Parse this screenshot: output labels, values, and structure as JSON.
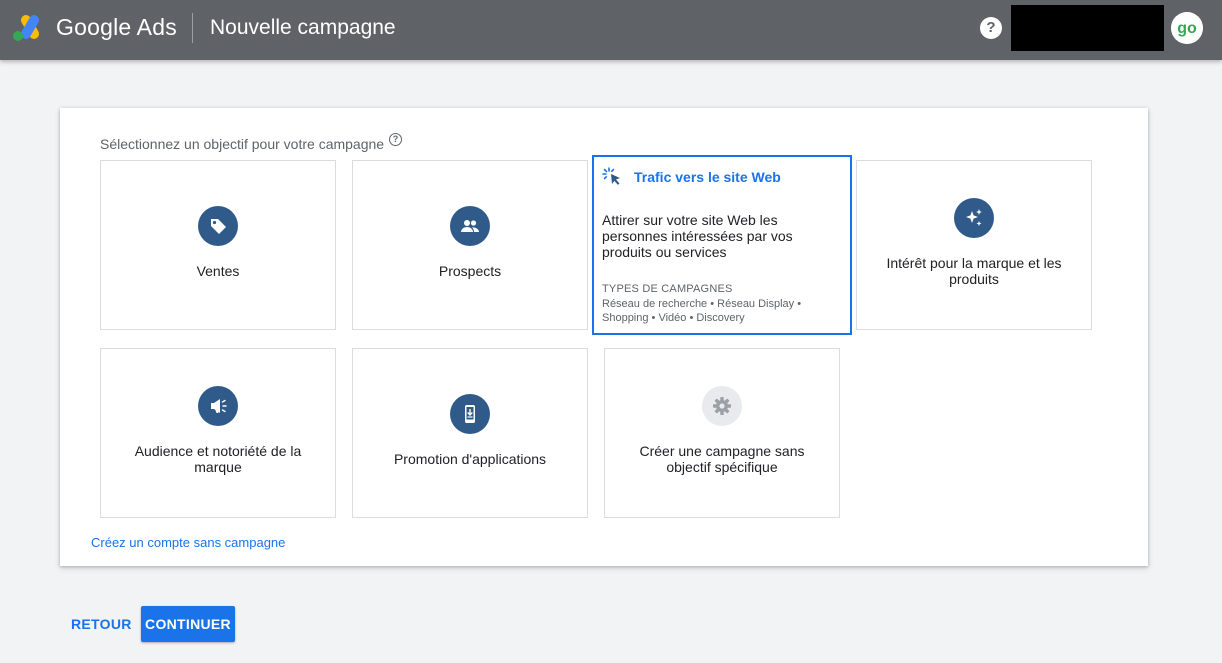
{
  "header": {
    "brand": "Google Ads",
    "page_title": "Nouvelle campagne",
    "help_icon": "?",
    "avatar_text": "go",
    "colors": {
      "bar": "#5f6368",
      "avatar": "#34a853"
    }
  },
  "objective": {
    "prompt": "Sélectionnez un objectif pour votre campagne",
    "prompt_help_icon": "?",
    "tiles": [
      {
        "label": "Ventes",
        "icon": "tag-icon"
      },
      {
        "label": "Prospects",
        "icon": "people-icon"
      },
      {
        "label": "Trafic vers le site Web",
        "icon": "cursor-click-icon",
        "selected": true,
        "description": "Attirer sur votre site Web les personnes intéressées par vos produits ou services",
        "types_heading": "TYPES DE CAMPAGNES",
        "types": "Réseau de recherche • Réseau Display • Shopping • Vidéo • Discovery"
      },
      {
        "label": "Intérêt pour la marque et les produits",
        "icon": "sparkle-icon"
      },
      {
        "label": "Audience et notoriété de la marque",
        "icon": "megaphone-icon"
      },
      {
        "label": "Promotion d'applications",
        "icon": "phone-download-icon"
      },
      {
        "label": "Créer une campagne sans objectif spécifique",
        "icon": "gear-icon"
      }
    ],
    "no_campaign_link": "Créez un compte sans campagne"
  },
  "footer": {
    "back_label": "RETOUR",
    "continue_label": "CONTINUER"
  },
  "colors": {
    "accent": "#1a73e8",
    "icon_circle": "#2f5a8a",
    "icon_circle_disabled": "#e8eaed"
  }
}
